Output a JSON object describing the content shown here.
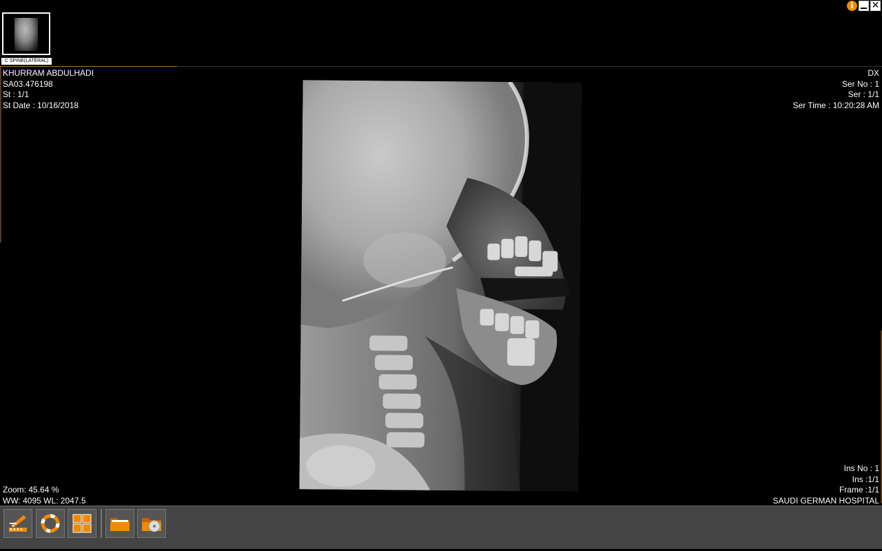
{
  "window": {
    "info_label": "i",
    "close_label": "✕"
  },
  "thumbnail": {
    "label": "C SPINE(LATERAL)"
  },
  "overlay": {
    "top_left": {
      "patient_name": "KHURRAM ABDULHADI",
      "patient_id": "SA03.476198",
      "study": "St : 1/1",
      "study_date": "St Date : 10/16/2018"
    },
    "top_right": {
      "modality": "DX",
      "series_no": "Ser No : 1",
      "series": "Ser : 1/1",
      "series_time": "Ser Time : 10:20:28 AM"
    },
    "bottom_left": {
      "zoom": "Zoom: 45.64 %",
      "window_level": "WW: 4095 WL: 2047.5"
    },
    "bottom_right": {
      "instance_no": "Ins No : 1",
      "instance": "Ins :1/1",
      "frame": "Frame :1/1",
      "institution": "SAUDI GERMAN HOSPITAL"
    }
  },
  "toolbar": {
    "buttons": [
      {
        "icon": "annotate-tools-icon"
      },
      {
        "icon": "reset-cycle-icon"
      },
      {
        "icon": "layout-grid-icon"
      },
      {
        "icon": "open-folder-icon"
      },
      {
        "icon": "cd-folder-icon"
      }
    ],
    "accent_color": "#f08a00"
  }
}
